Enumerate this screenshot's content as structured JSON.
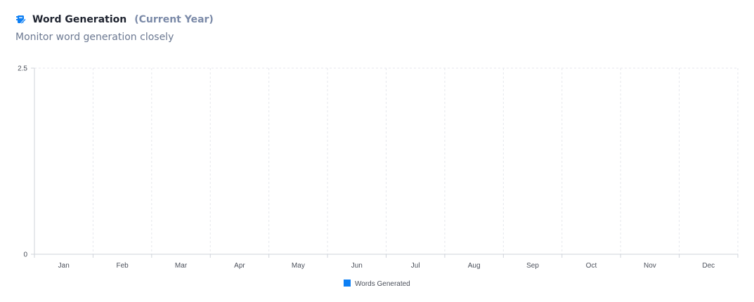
{
  "header": {
    "title": "Word Generation",
    "title_suffix": "(Current Year)",
    "subtitle": "Monitor word generation closely",
    "icon": "notebook-pen-icon"
  },
  "colors": {
    "accent": "#0d7ff4",
    "grid": "#e5e7ec",
    "axis": "#cfd3da",
    "tick_text": "#4a4f5a"
  },
  "chart_data": {
    "type": "bar",
    "categories": [
      "Jan",
      "Feb",
      "Mar",
      "Apr",
      "May",
      "Jun",
      "Jul",
      "Aug",
      "Sep",
      "Oct",
      "Nov",
      "Dec"
    ],
    "series": [
      {
        "name": "Words Generated",
        "values": [
          0,
          0,
          0,
          0,
          0,
          0,
          0,
          0,
          0,
          0,
          0,
          0
        ],
        "color": "#0d7ff4"
      }
    ],
    "yticks": [
      "0",
      "2.5"
    ],
    "ylim": [
      0,
      2.5
    ],
    "grid": true,
    "legend_position": "bottom-center"
  }
}
